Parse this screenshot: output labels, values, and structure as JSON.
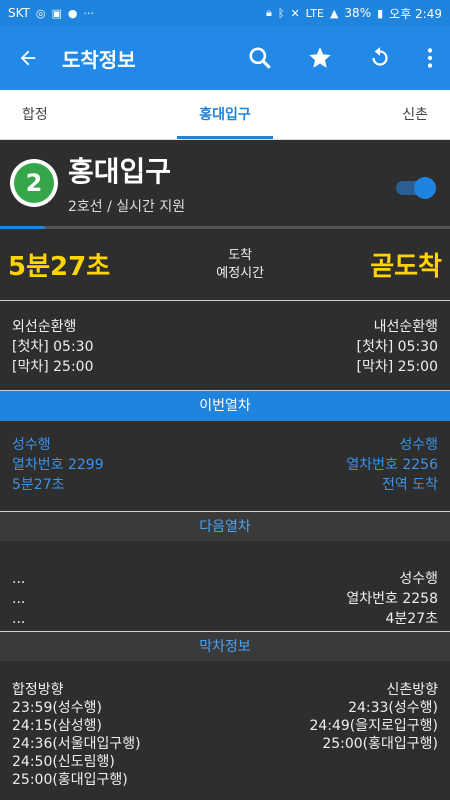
{
  "status": {
    "carrier": "SKT",
    "battery": "38%",
    "time": "오후 2:49",
    "icons": [
      "instagram-icon",
      "gallery-icon",
      "chat-icon",
      "more-dots-icon",
      "lock-icon",
      "bluetooth-icon",
      "mute-icon",
      "lte-icon",
      "signal-icon",
      "battery-icon"
    ]
  },
  "appbar": {
    "title": "도착정보"
  },
  "tabs": [
    {
      "label": "합정"
    },
    {
      "label": "홍대입구"
    },
    {
      "label": "신촌"
    }
  ],
  "station": {
    "line_number": "2",
    "line_color": "#35a649",
    "name": "홍대입구",
    "subtitle": "2호선 / 실시간 지원",
    "realtime_enabled": true,
    "progress_fraction": 0.1
  },
  "arrival": {
    "left_time": "5분27초",
    "label_line1": "도착",
    "label_line2": "예정시간",
    "right_status": "곧도착"
  },
  "first_last": {
    "left": {
      "direction": "외선순환행",
      "first": "[첫차] 05:30",
      "last": "[막차] 25:00"
    },
    "right": {
      "direction": "내선순환행",
      "first": "[첫차] 05:30",
      "last": "[막차] 25:00"
    }
  },
  "current_train": {
    "header": "이번열차",
    "left": {
      "dest": "성수행",
      "number": "열차번호 2299",
      "eta": "5분27초"
    },
    "right": {
      "dest": "성수행",
      "number": "열차번호 2256",
      "eta": "전역 도착"
    }
  },
  "next_train": {
    "header": "다음열차",
    "left": {
      "l1": "...",
      "l2": "...",
      "l3": "..."
    },
    "right": {
      "dest": "성수행",
      "number": "열차번호 2258",
      "eta": "4분27초"
    }
  },
  "last_train": {
    "header": "막차정보",
    "left": {
      "direction": "합정방향",
      "items": [
        "23:59(성수행)",
        "24:15(삼성행)",
        "24:36(서울대입구행)",
        "24:50(신도림행)",
        "25:00(홍대입구행)"
      ]
    },
    "right": {
      "direction": "신촌방향",
      "items": [
        "24:33(성수행)",
        "24:49(을지로입구행)",
        "25:00(홍대입구행)"
      ]
    }
  }
}
